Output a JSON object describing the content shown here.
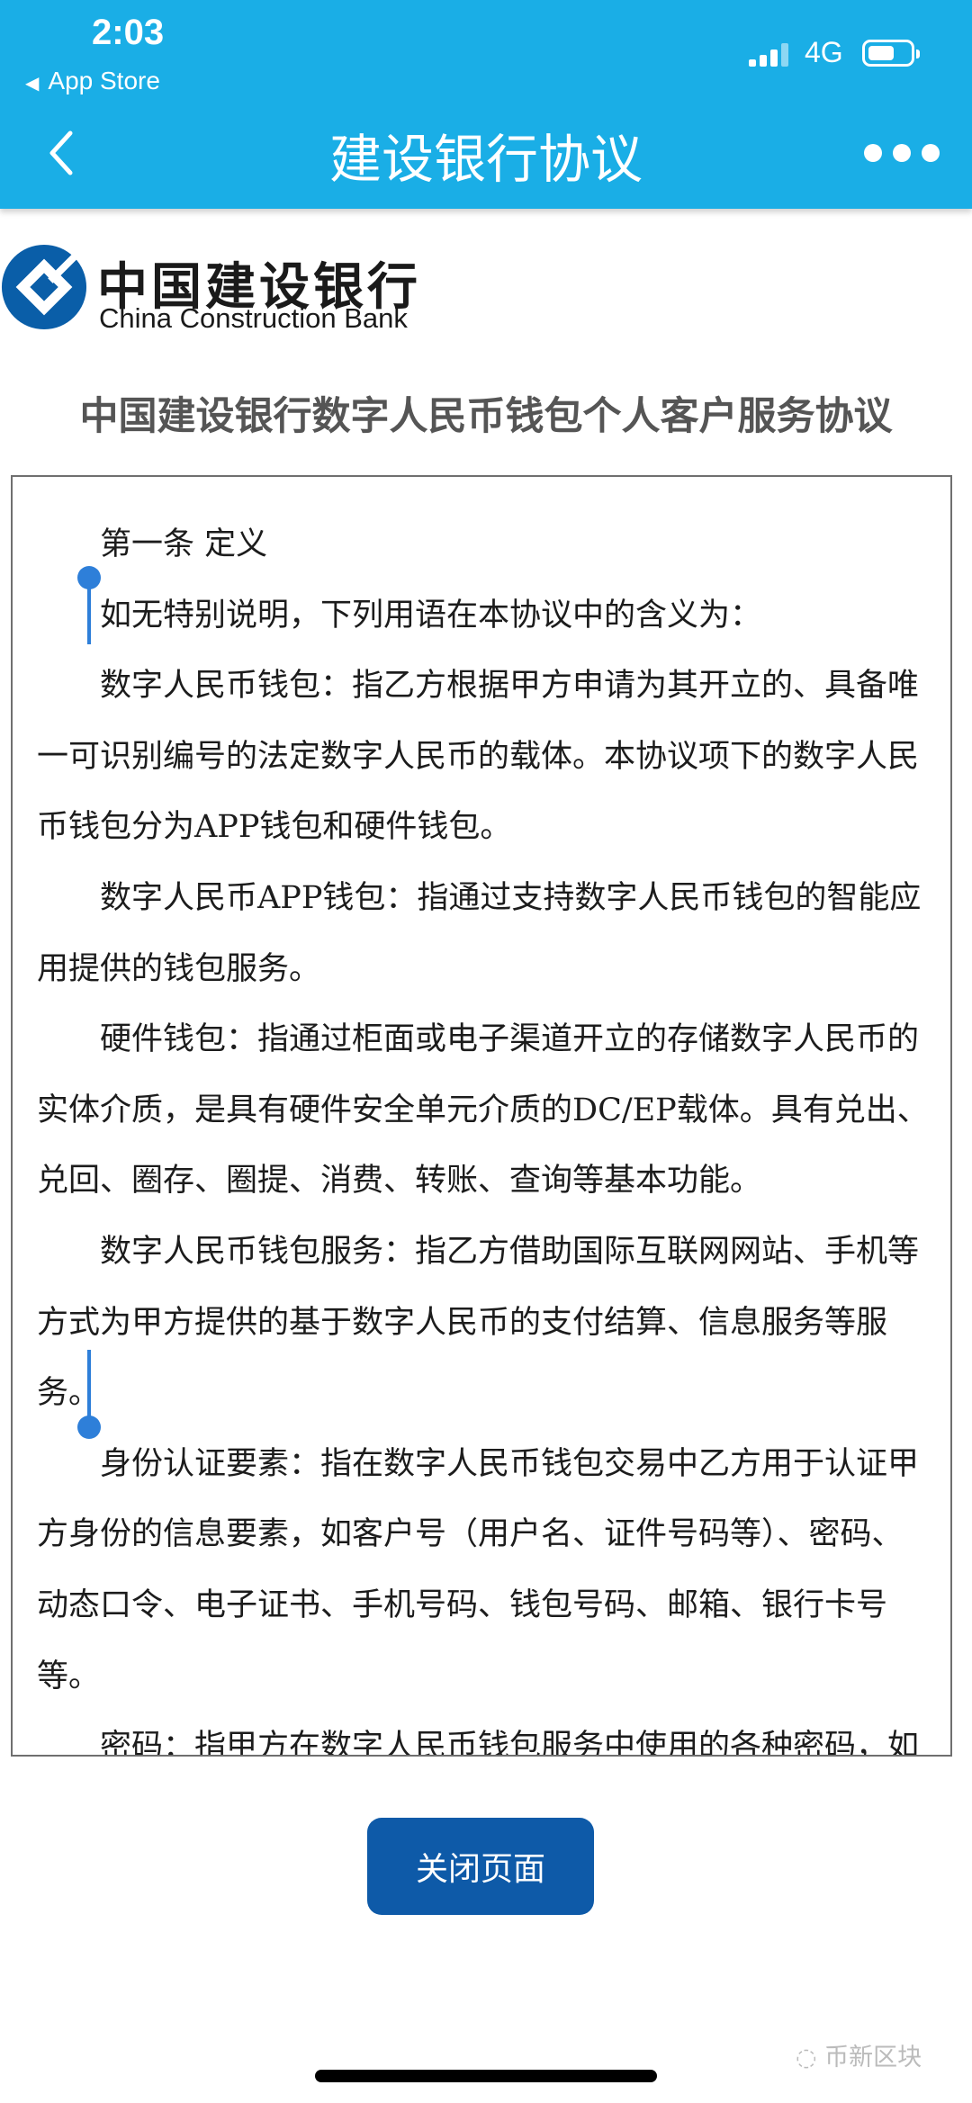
{
  "status_bar": {
    "time": "2:03",
    "back_app": "App Store",
    "network": "4G"
  },
  "nav": {
    "title": "建设银行协议"
  },
  "logo": {
    "cn": "中国建设银行",
    "en": "China Construction Bank"
  },
  "doc_title": "中国建设银行数字人民币钱包个人客户服务协议",
  "document": {
    "lines": [
      "第一条  定义",
      "如无特别说明，下列用语在本协议中的含义为：",
      "数字人民币钱包：指乙方根据甲方申请为其开立的、具备唯",
      "一可识别编号的法定数字人民币的载体。本协议项下的数字人民",
      "币钱包分为APP钱包和硬件钱包。",
      "数字人民币APP钱包：指通过支持数字人民币钱包的智能应",
      "用提供的钱包服务。",
      "硬件钱包：指通过柜面或电子渠道开立的存储数字人民币的",
      "实体介质，是具有硬件安全单元介质的DC/EP载体。具有兑出、",
      "兑回、圈存、圈提、消费、转账、查询等基本功能。",
      "数字人民币钱包服务：指乙方借助国际互联网网站、手机等",
      "方式为甲方提供的基于数字人民币的支付结算、信息服务等服",
      "务。",
      "身份认证要素：指在数字人民币钱包交易中乙方用于认证甲",
      "方身份的信息要素，如客户号（用户名、证件号码等）、密码、",
      "动态口令、电子证书、手机号码、钱包号码、邮箱、银行卡号",
      "等。",
      "密码：指甲方在数字人民币钱包服务中使用的各种密码，如"
    ]
  },
  "close_button": "关闭页面",
  "watermark": "币新区块",
  "colors": {
    "header": "#1aaee6",
    "button": "#0e5aa8",
    "selection": "#cde0f0",
    "handle": "#2e7fd9"
  }
}
